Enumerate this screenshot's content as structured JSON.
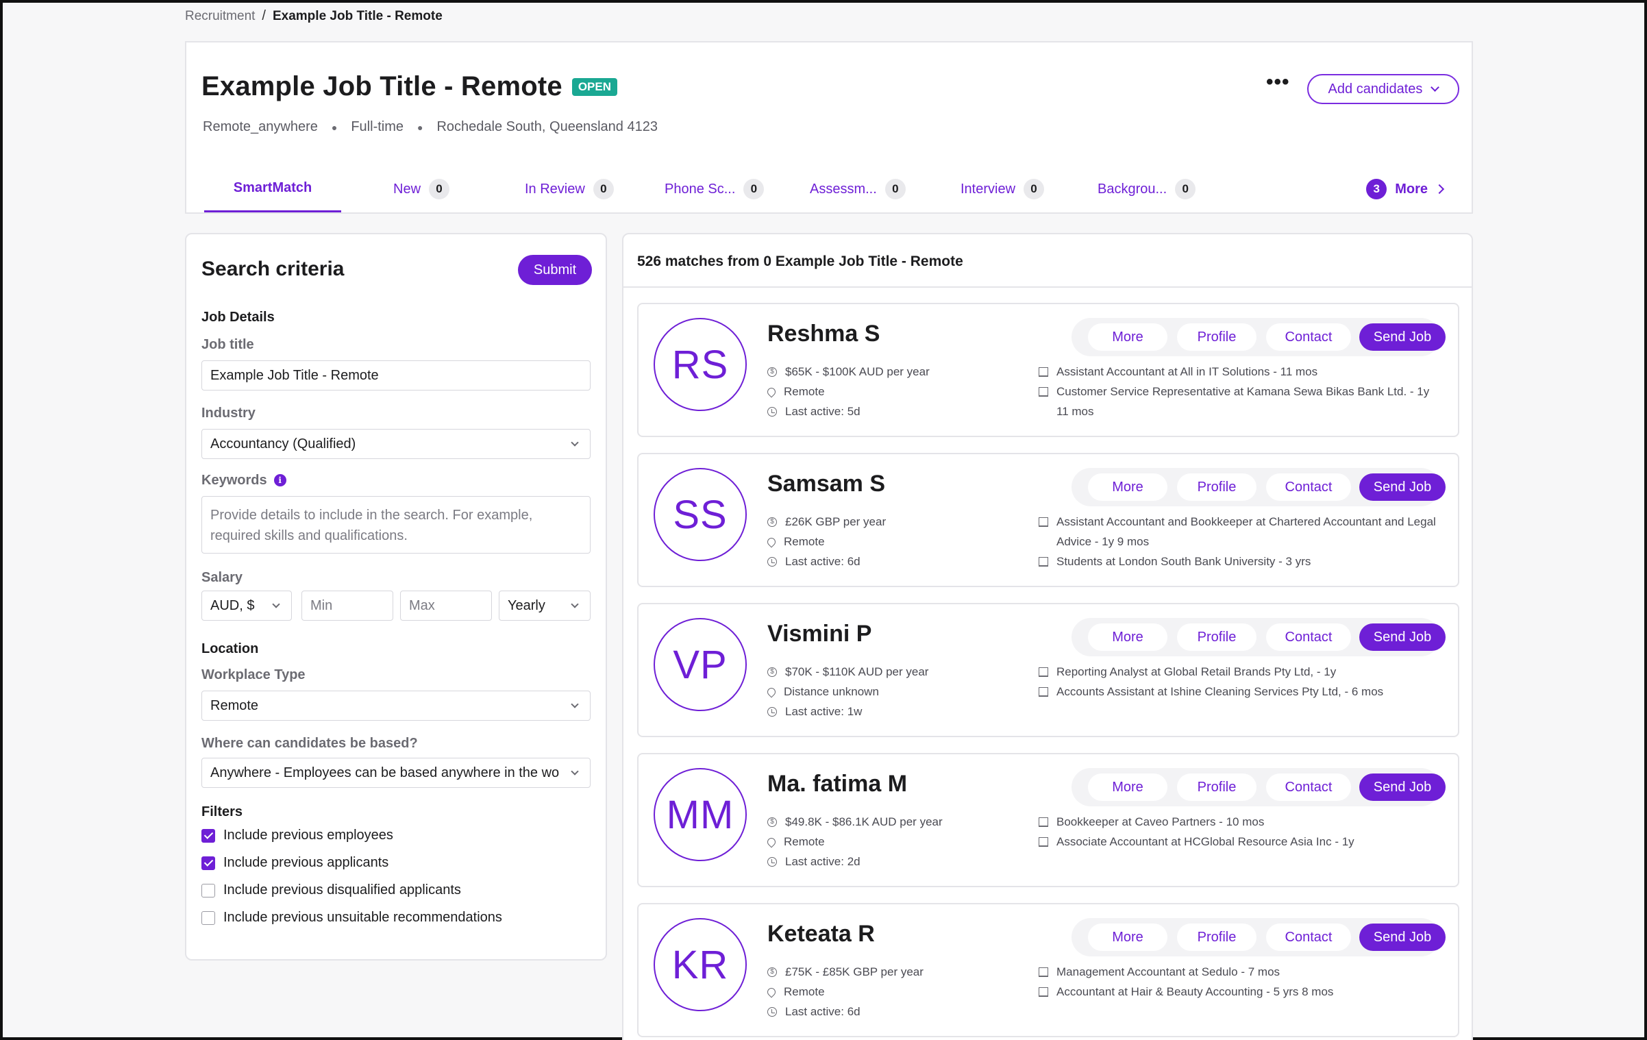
{
  "breadcrumb": {
    "parent": "Recruitment",
    "separator": "/",
    "current": "Example Job Title - Remote"
  },
  "job": {
    "title": "Example Job Title - Remote",
    "status": "OPEN",
    "workplace": "Remote_anywhere",
    "type": "Full-time",
    "location": "Rochedale South, Queensland 4123",
    "more_menu": "•••",
    "add_candidates": "Add candidates"
  },
  "tabs": [
    {
      "label": "SmartMatch",
      "count": null
    },
    {
      "label": "New",
      "count": "0"
    },
    {
      "label": "In Review",
      "count": "0"
    },
    {
      "label": "Phone Sc...",
      "count": "0"
    },
    {
      "label": "Assessm...",
      "count": "0"
    },
    {
      "label": "Interview",
      "count": "0"
    },
    {
      "label": "Backgrou...",
      "count": "0"
    }
  ],
  "tabs_more": {
    "count": "3",
    "label": "More"
  },
  "search": {
    "title": "Search criteria",
    "submit": "Submit",
    "job_details_heading": "Job Details",
    "job_title_label": "Job title",
    "job_title_value": "Example Job Title - Remote",
    "industry_label": "Industry",
    "industry_value": "Accountancy (Qualified)",
    "keywords_label": "Keywords",
    "keywords_info": "i",
    "keywords_placeholder": "Provide details to include in the search. For example, required skills and qualifications.",
    "salary_label": "Salary",
    "salary_currency": "AUD, $",
    "salary_min_placeholder": "Min",
    "salary_max_placeholder": "Max",
    "salary_period": "Yearly",
    "location_heading": "Location",
    "workplace_type_label": "Workplace Type",
    "workplace_type_value": "Remote",
    "based_label": "Where can candidates be based?",
    "based_value": "Anywhere - Employees can be based anywhere in the wo",
    "filters_heading": "Filters",
    "filters": [
      {
        "label": "Include previous employees",
        "checked": true
      },
      {
        "label": "Include previous applicants",
        "checked": true
      },
      {
        "label": "Include previous disqualified applicants",
        "checked": false
      },
      {
        "label": "Include previous unsuitable recommendations",
        "checked": false
      }
    ]
  },
  "results": {
    "header": "526 matches from 0 Example Job Title - Remote",
    "actions": {
      "more": "More",
      "profile": "Profile",
      "contact": "Contact",
      "send": "Send Job"
    },
    "candidates": [
      {
        "initials": "RS",
        "name": "Reshma S",
        "salary": "$65K - $100K AUD per year",
        "location": "Remote",
        "last_active": "Last active: 5d",
        "experience": [
          "Assistant Accountant at All in IT Solutions - 11 mos",
          "Customer Service Representative at Kamana Sewa Bikas Bank Ltd. - 1y 11 mos"
        ]
      },
      {
        "initials": "SS",
        "name": "Samsam S",
        "salary": "£26K GBP per year",
        "location": "Remote",
        "last_active": "Last active: 6d",
        "experience": [
          "Assistant Accountant and Bookkeeper at Chartered Accountant and Legal Advice - 1y 9 mos",
          "Students at London South Bank University - 3 yrs"
        ]
      },
      {
        "initials": "VP",
        "name": "Vismini P",
        "salary": "$70K - $110K AUD per year",
        "location": "Distance unknown",
        "last_active": "Last active: 1w",
        "experience": [
          "Reporting Analyst at Global Retail Brands Pty Ltd, - 1y",
          "Accounts Assistant at Ishine Cleaning Services Pty Ltd, - 6 mos"
        ]
      },
      {
        "initials": "MM",
        "name": "Ma. fatima M",
        "salary": "$49.8K - $86.1K AUD per year",
        "location": "Remote",
        "last_active": "Last active: 2d",
        "experience": [
          "Bookkeeper at Caveo Partners - 10 mos",
          "Associate Accountant at HCGlobal Resource Asia Inc - 1y"
        ]
      },
      {
        "initials": "KR",
        "name": "Keteata R",
        "salary": "£75K - £85K GBP per year",
        "location": "Remote",
        "last_active": "Last active: 6d",
        "experience": [
          "Management Accountant at Sedulo - 7 mos",
          "Accountant at Hair & Beauty Accounting - 5 yrs 8 mos"
        ]
      }
    ]
  }
}
